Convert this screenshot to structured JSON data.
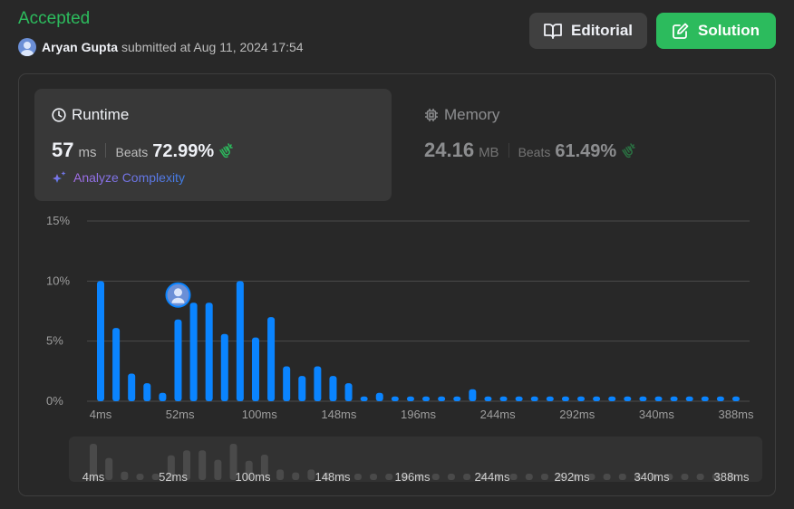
{
  "header": {
    "status": "Accepted",
    "user_name": "Aryan Gupta",
    "submitted_text": "submitted at Aug 11, 2024 17:54"
  },
  "buttons": {
    "editorial": "Editorial",
    "solution": "Solution"
  },
  "runtime": {
    "title": "Runtime",
    "value": "57",
    "unit": "ms",
    "beats_label": "Beats",
    "beats_pct": "72.99%",
    "analyze_label": "Analyze Complexity"
  },
  "memory": {
    "title": "Memory",
    "value": "24.16",
    "unit": "MB",
    "beats_label": "Beats",
    "beats_pct": "61.49%"
  },
  "colors": {
    "accepted": "#2cbb5d",
    "bar": "#0a84ff",
    "nav_bar": "#4a4a4a"
  },
  "chart_data": {
    "type": "bar",
    "y_tick_labels": [
      "0%",
      "5%",
      "10%",
      "15%"
    ],
    "y_ticks": [
      0,
      5,
      10,
      15
    ],
    "ylim": [
      0,
      15
    ],
    "x_tick_labels": [
      "4ms",
      "52ms",
      "100ms",
      "148ms",
      "196ms",
      "244ms",
      "292ms",
      "340ms",
      "388ms"
    ],
    "values": [
      10.0,
      6.1,
      2.3,
      1.5,
      0.7,
      6.8,
      8.2,
      8.2,
      5.6,
      10.0,
      5.3,
      7.0,
      2.9,
      2.1,
      2.9,
      2.1,
      1.5,
      0.4,
      0.7,
      0.4,
      0.4,
      0.4,
      0.4,
      0.4,
      1.0,
      0.4,
      0.4,
      0.4,
      0.4,
      0.4,
      0.4,
      0.4,
      0.4,
      0.4,
      0.4,
      0.4,
      0.4,
      0.4,
      0.4,
      0.4,
      0.4,
      0.4
    ],
    "user_bar_index": 5,
    "navigator_tick_labels": [
      "4ms",
      "52ms",
      "100ms",
      "148ms",
      "196ms",
      "244ms",
      "292ms",
      "340ms",
      "388ms"
    ]
  }
}
